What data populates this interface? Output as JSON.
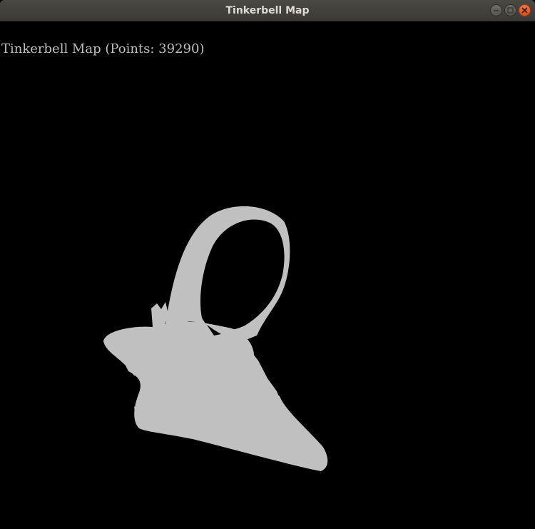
{
  "window": {
    "title": "Tinkerbell Map",
    "controls": [
      "minimize",
      "maximize",
      "close"
    ]
  },
  "canvas": {
    "background": "#000000",
    "point_color": "#c0c0c0",
    "label": "Tinkerbell Map (Points: 39290)"
  },
  "icons": {
    "minimize": "minimize-icon",
    "maximize": "maximize-icon",
    "close": "close-icon"
  }
}
